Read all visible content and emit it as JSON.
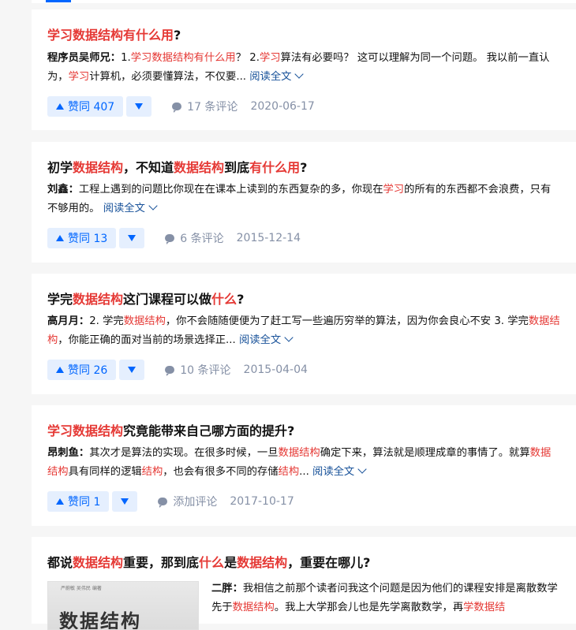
{
  "cards": [
    {
      "title": [
        {
          "t": "学习数据结构有什么用",
          "h": true
        },
        {
          "t": "?",
          "h": false
        }
      ],
      "author": "程序员吴师兄：",
      "excerpt": [
        {
          "t": "1.",
          "h": false
        },
        {
          "t": "学习数据结构有什么用",
          "h": true
        },
        {
          "t": "？ 2.",
          "h": false
        },
        {
          "t": "学习",
          "h": true
        },
        {
          "t": "算法有必要吗？ 这可以理解为同一个问题。 我以前一直认为，",
          "h": false
        },
        {
          "t": "学习",
          "h": true
        },
        {
          "t": "计算机，必须要懂算法，不仅要...",
          "h": false
        }
      ],
      "read_more": "阅读全文",
      "votes": "赞同 407",
      "comments": "17 条评论",
      "date": "2020-06-17"
    },
    {
      "title": [
        {
          "t": "初学",
          "h": false
        },
        {
          "t": "数据结构",
          "h": true
        },
        {
          "t": "，不知道",
          "h": false
        },
        {
          "t": "数据结构",
          "h": true
        },
        {
          "t": "到底",
          "h": false
        },
        {
          "t": "有什么用",
          "h": true
        },
        {
          "t": "?",
          "h": false
        }
      ],
      "author": "刘鑫：",
      "excerpt": [
        {
          "t": "工程上遇到的问题比你现在在课本上读到的东西复杂的多，你现在",
          "h": false
        },
        {
          "t": "学习",
          "h": true
        },
        {
          "t": "的所有的东西都不会浪费，只有不够用的。",
          "h": false
        }
      ],
      "read_more": "阅读全文",
      "votes": "赞同 13",
      "comments": "6 条评论",
      "date": "2015-12-14"
    },
    {
      "title": [
        {
          "t": "学完",
          "h": false
        },
        {
          "t": "数据结构",
          "h": true
        },
        {
          "t": "这门课程可以做",
          "h": false
        },
        {
          "t": "什么",
          "h": true
        },
        {
          "t": "?",
          "h": false
        }
      ],
      "author": "高月月：",
      "excerpt": [
        {
          "t": "2. 学完",
          "h": false
        },
        {
          "t": "数据结构",
          "h": true
        },
        {
          "t": "，你不会随随便便为了赶工写一些遍历穷举的算法，因为你会良心不安 3. 学完",
          "h": false
        },
        {
          "t": "数据结构",
          "h": true
        },
        {
          "t": "，你能正确的面对当前的场景选择正...",
          "h": false
        }
      ],
      "read_more": "阅读全文",
      "votes": "赞同 26",
      "comments": "10 条评论",
      "date": "2015-04-04"
    },
    {
      "title": [
        {
          "t": "学习数据结构",
          "h": true
        },
        {
          "t": "究竟能带来自己哪方面的提升?",
          "h": false
        }
      ],
      "author": "昂刺鱼：",
      "excerpt": [
        {
          "t": "其次才是算法的实现。在很多时候，一旦",
          "h": false
        },
        {
          "t": "数据结构",
          "h": true
        },
        {
          "t": "确定下来，算法就是顺理成章的事情了。就算",
          "h": false
        },
        {
          "t": "数据结构",
          "h": true
        },
        {
          "t": "具有同样的逻辑",
          "h": false
        },
        {
          "t": "结构",
          "h": true
        },
        {
          "t": "，也会有很多不同的存储",
          "h": false
        },
        {
          "t": "结构",
          "h": true
        },
        {
          "t": "...",
          "h": false
        }
      ],
      "read_more": "阅读全文",
      "votes": "赞同 1",
      "comments": "添加评论",
      "date": "2017-10-17"
    },
    {
      "title": [
        {
          "t": "都说",
          "h": false
        },
        {
          "t": "数据结构",
          "h": true
        },
        {
          "t": "重要，那到底",
          "h": false
        },
        {
          "t": "什么",
          "h": true
        },
        {
          "t": "是",
          "h": false
        },
        {
          "t": "数据结构",
          "h": true
        },
        {
          "t": "，重要在哪儿?",
          "h": false
        }
      ],
      "author": "二胖：",
      "excerpt": [
        {
          "t": "我相信之前那个读者问我这个问题是因为他们的课程安排是离散数学先于",
          "h": false
        },
        {
          "t": "数据结构",
          "h": true
        },
        {
          "t": "。我上大学那会儿也是先学离散数学，再",
          "h": false
        },
        {
          "t": "学数据结",
          "h": true
        }
      ],
      "thumb_small": "严蔚敏 吴伟民 编著",
      "thumb_big": "数据结构"
    }
  ]
}
